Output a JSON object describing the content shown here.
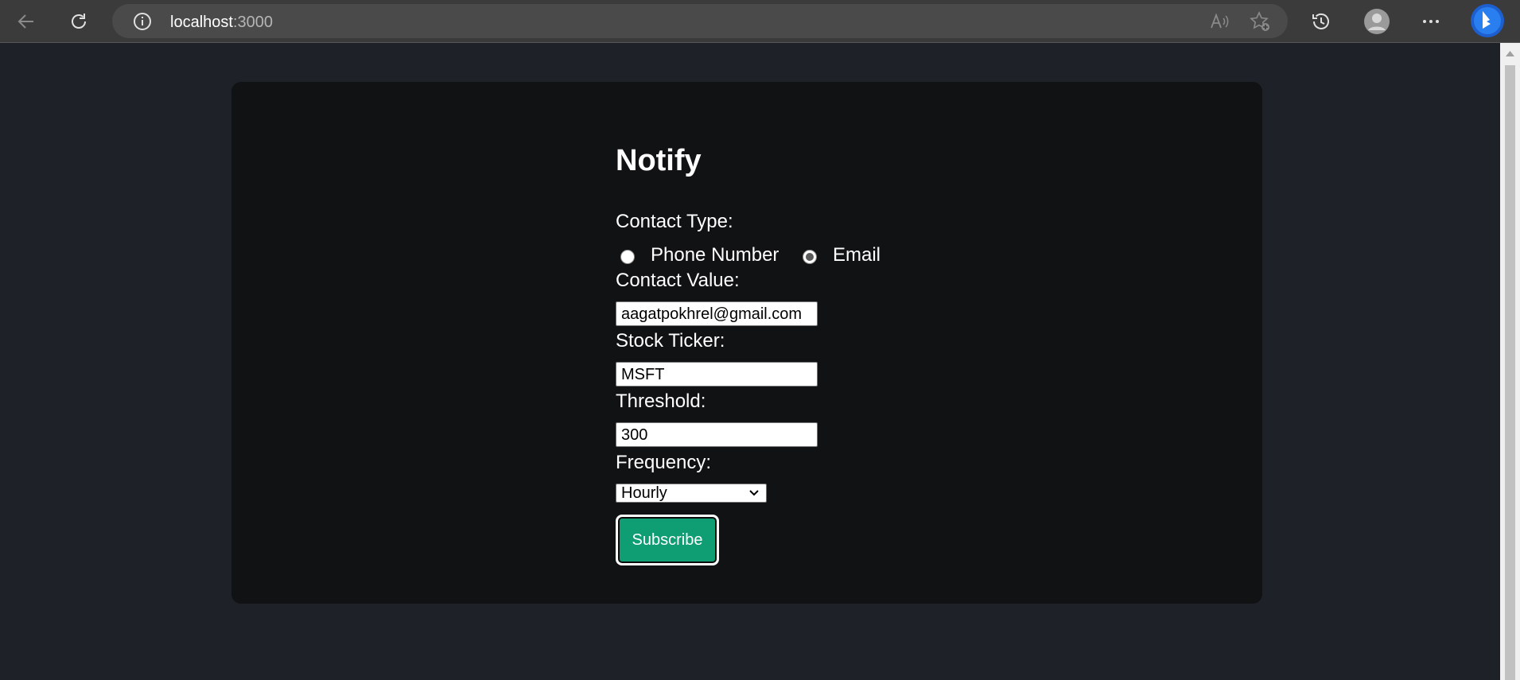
{
  "browser": {
    "url_host": "localhost",
    "url_port": ":3000"
  },
  "form": {
    "title": "Notify",
    "contact_type_label": "Contact Type:",
    "contact_type_options": [
      "Phone Number",
      "Email"
    ],
    "contact_type_selected": "Email",
    "contact_value_label": "Contact Value:",
    "contact_value": "aagatpokhrel@gmail.com",
    "stock_ticker_label": "Stock Ticker:",
    "stock_ticker": "MSFT",
    "threshold_label": "Threshold:",
    "threshold": "300",
    "frequency_label": "Frequency:",
    "frequency": "Hourly",
    "submit_label": "Subscribe"
  },
  "colors": {
    "page_bg": "#1f2129",
    "card_bg": "#111214",
    "button_bg": "#0f9e74"
  }
}
